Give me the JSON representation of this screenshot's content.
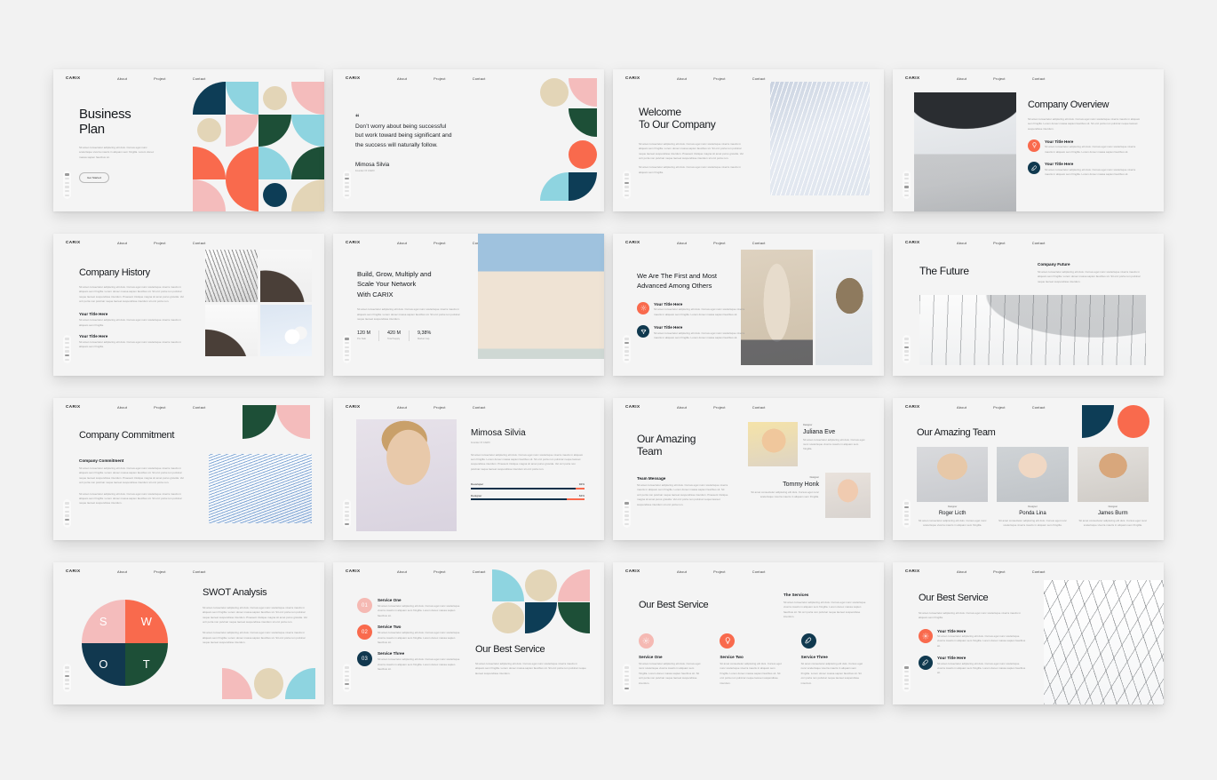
{
  "brand": "CARIX",
  "nav": [
    "About",
    "Project",
    "Contact"
  ],
  "lorem": {
    "short": "Sit amet consectetur adipiscing elit duis. Cursus eget nunc scelerisque viverra mauris in aliquam sem fringilla. Lorem donec massa sapien faucibus sit.",
    "mid": "Sit amet consectetur adipiscing elit duis. Cursus eget nunc scelerisque viverra mauris in aliquam sem fringilla. Lorem donec massa sapien faucibus sit. Sit orci porta non pulvinar neque laoreet suspendisse interdum.",
    "long": "Sit amet consectetur adipiscing elit duis. Cursus eget nunc scelerisque viverra mauris in aliquam sem fringilla. Lorem donec massa sapien faucibus sit. Sit orci porta non pulvinar neque laoreet suspendisse interdum. Praesent tristique magna sit amet purus gravida. Vel orci porta non pulvinar neque laoreet suspendisse interdum sit orci porta non.",
    "xshort": "Sit amet consectetur adipiscing elit duis. Cursus eget nunc scelerisque viverra mauris in aliquam sem fringilla."
  },
  "slides": {
    "s1": {
      "title_line1": "Business",
      "title_line2": "Plan",
      "button": "Get Started"
    },
    "s2": {
      "quote_mark": "“",
      "quote_line1": "Don’t worry about being successful",
      "quote_line2": "but work toward being significant and",
      "quote_line3": "the success will naturally follow.",
      "author": "Mimosa Silvia",
      "role": "Founder Of CARIX"
    },
    "s3": {
      "title_line1": "Welcome",
      "title_line2": "To Our Company"
    },
    "s4": {
      "title": "Company Overview",
      "feature1_title": "Your Title Here",
      "feature2_title": "Your Title Here",
      "icon1": "lightbulb-icon",
      "icon2": "rocket-icon"
    },
    "s5": {
      "title": "Company History",
      "sub1": "Your Title Here",
      "sub2": "Your Title Here"
    },
    "s6": {
      "title_line1": "Build, Grow, Multiply and",
      "title_line2": "Scale Your Network",
      "title_line3": "With CARIX",
      "stats": [
        {
          "value": "120 M",
          "label": "Pre Sale"
        },
        {
          "value": "420 M",
          "label": "Total Supply"
        },
        {
          "value": "9,38%",
          "label": "Market Cap"
        }
      ]
    },
    "s7": {
      "title_line1": "We Are The First and Most",
      "title_line2": "Advanced Among Others",
      "feature1_title": "Your Title Here",
      "feature2_title": "Your Title Here",
      "icon1": "gear-icon",
      "icon2": "trophy-icon"
    },
    "s8": {
      "title": "The Future",
      "side_title": "Company Future"
    },
    "s9": {
      "title": "Company Commitment",
      "sub": "Company Commitment"
    },
    "s10": {
      "name": "Mimosa Silvia",
      "role": "Founder Of CARIX",
      "bars": [
        {
          "label": "Developer",
          "value": 92,
          "value_text": "92%"
        },
        {
          "label": "Designer",
          "value": 84,
          "value_text": "84%"
        }
      ]
    },
    "s11": {
      "title_line1": "Our Amazing",
      "title_line2": "Team",
      "sub": "Team Message",
      "member1_role": "Designer",
      "member1_name": "Juliana Eve",
      "member2_role": "Designer",
      "member2_name": "Tommy Honk"
    },
    "s12": {
      "title": "Our Amazing Team",
      "members": [
        {
          "role": "Designer",
          "name": "Roger Licth"
        },
        {
          "role": "Designer",
          "name": "Ponda Lina"
        },
        {
          "role": "Designer",
          "name": "James Burm"
        }
      ]
    },
    "s13": {
      "title": "SWOT Analysis",
      "quadrants": [
        {
          "letter": "S",
          "color": "#f4bcbc"
        },
        {
          "letter": "W",
          "color": "#f96a4d"
        },
        {
          "letter": "O",
          "color": "#11384f"
        },
        {
          "letter": "T",
          "color": "#1d4f37"
        }
      ]
    },
    "s14": {
      "title": "Our Best Service",
      "items": [
        {
          "num": "01",
          "label": "Service One"
        },
        {
          "num": "02",
          "label": "Service Two"
        },
        {
          "num": "03",
          "label": "Service Three"
        }
      ]
    },
    "s15": {
      "title": "Our Best Service",
      "side_title": "The Services",
      "items": [
        {
          "label": "Service One",
          "icon": "gear-icon"
        },
        {
          "label": "Service Two",
          "icon": "bulb-icon"
        },
        {
          "label": "Service Three",
          "icon": "rocket-icon"
        }
      ]
    },
    "s16": {
      "title": "Our Best Service",
      "feature1_title": "Your Title Here",
      "feature2_title": "Your Title Here",
      "icon1": "gear-icon",
      "icon2": "rocket-icon"
    }
  },
  "palette": {
    "navy": "#0d3d56",
    "sky": "#8ed4e0",
    "sand": "#e3d5b7",
    "pink": "#f4bcbc",
    "coral": "#f96a4d",
    "green": "#1d4f37",
    "background": "#f2f2f2",
    "slide_bg": "#f4f4f4"
  }
}
